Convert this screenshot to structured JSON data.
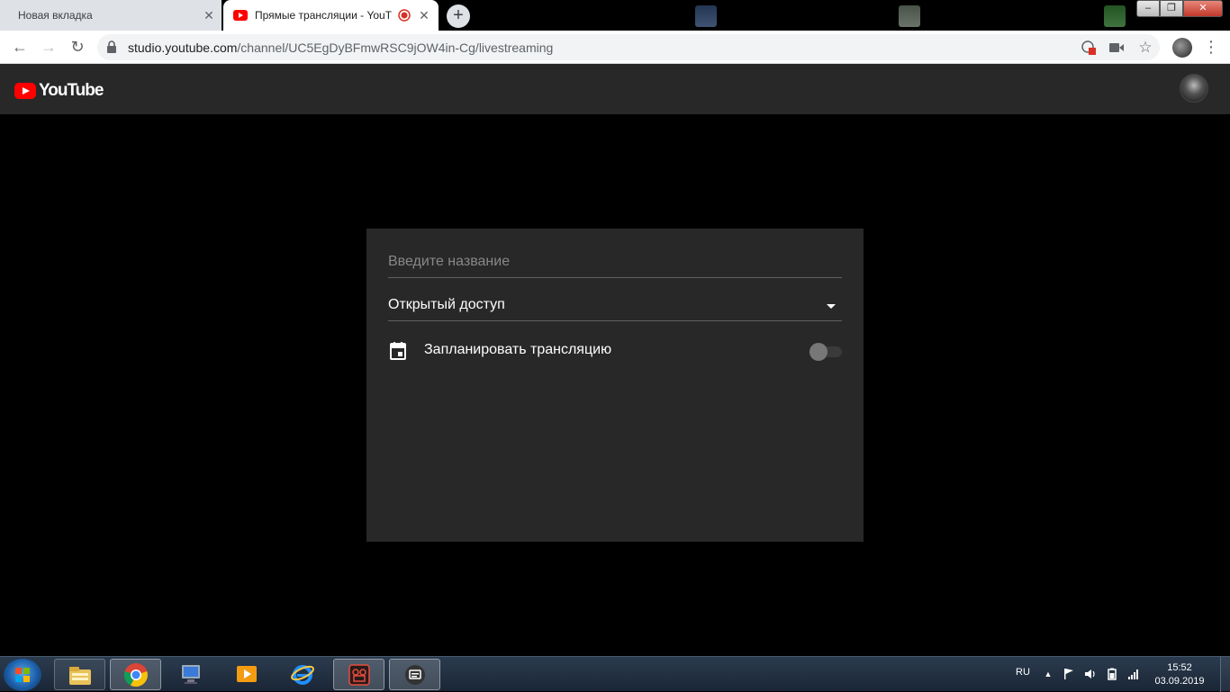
{
  "browser": {
    "tabs": [
      {
        "title": "Новая вкладка",
        "active": false
      },
      {
        "title": "Прямые трансляции - YouT",
        "active": true
      }
    ],
    "new_tab_label": "+",
    "url_host": "studio.youtube.com",
    "url_path": "/channel/UC5EgDyBFmwRSC9jOW4in-Cg/livestreaming",
    "window_controls": {
      "minimize": "–",
      "restore": "❐",
      "close": "✕"
    }
  },
  "youtube": {
    "logo_text": "YouTube",
    "brand_color": "#ff0000"
  },
  "dialog": {
    "title_placeholder": "Введите название",
    "title_value": "",
    "privacy_value": "Открытый доступ",
    "schedule_label": "Запланировать трансляцию",
    "schedule_enabled": false
  },
  "taskbar": {
    "pinned": [
      "explorer-icon",
      "chrome-icon",
      "computer-icon",
      "media-player-icon",
      "ie-icon",
      "video-editor-icon",
      "message-icon"
    ],
    "language": "RU",
    "time": "15:52",
    "date": "03.09.2019"
  }
}
